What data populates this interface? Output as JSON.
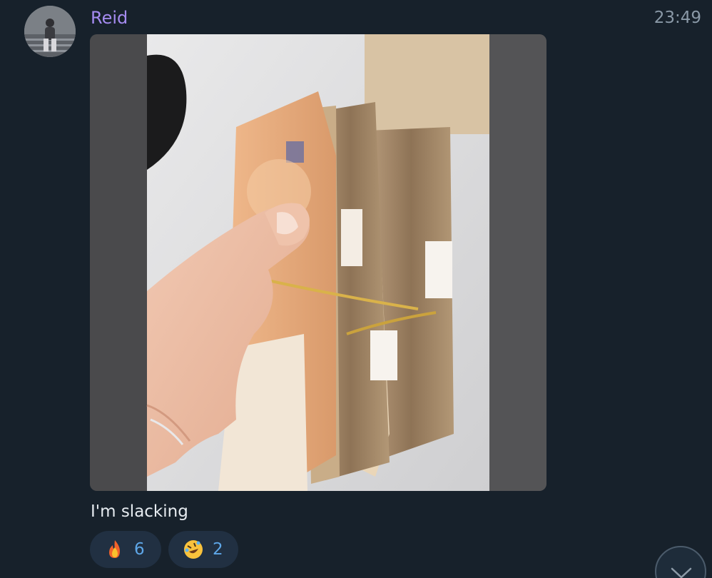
{
  "message": {
    "sender": "Reid",
    "time": "23:49",
    "caption": "I'm slacking"
  },
  "reactions": [
    {
      "emoji": "fire-emoji",
      "count": "6"
    },
    {
      "emoji": "rofl-emoji",
      "count": "2"
    }
  ],
  "icons": {
    "avatar": "user-avatar",
    "scroll": "chevron-down-icon"
  },
  "colors": {
    "background": "#17212b",
    "sender": "#a58bf0",
    "time": "#8a99a7",
    "reaction_bg": "#213042",
    "reaction_count": "#5ea7e8"
  }
}
